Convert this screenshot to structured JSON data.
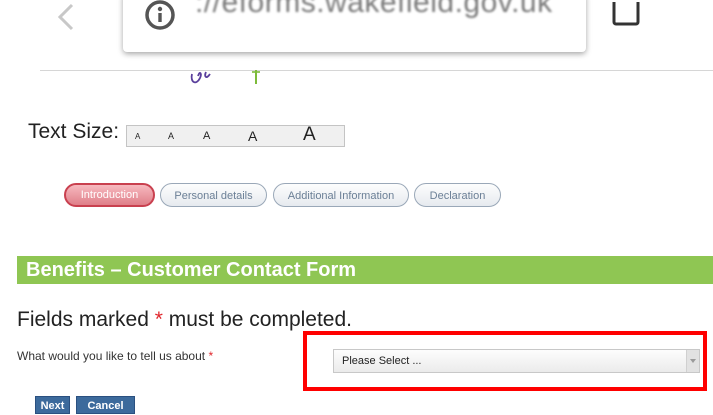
{
  "browser": {
    "url": "://eforms.wakefield.gov.uk"
  },
  "text_size": {
    "label": "Text Size:",
    "options": [
      "A",
      "A",
      "A",
      "A",
      "A"
    ]
  },
  "steps": [
    {
      "label": "Introduction",
      "state": "active"
    },
    {
      "label": "Personal details",
      "state": "inactive"
    },
    {
      "label": "Additional Information",
      "state": "inactive"
    },
    {
      "label": "Declaration",
      "state": "inactive"
    }
  ],
  "form": {
    "title": "Benefits – Customer Contact Form",
    "required_prefix": "Fields marked ",
    "required_star": "*",
    "required_suffix": " must be completed.",
    "question_label": "What would you like to tell us about ",
    "question_star": "*",
    "select_value": "Please Select ..."
  },
  "buttons": {
    "next": "Next",
    "cancel": "Cancel"
  },
  "colors": {
    "header_green": "#8fc653",
    "required_red": "#e0262c",
    "highlight_red": "#ff0000",
    "button_blue": "#3c6a9c",
    "active_step_pink": "#df7f89"
  }
}
